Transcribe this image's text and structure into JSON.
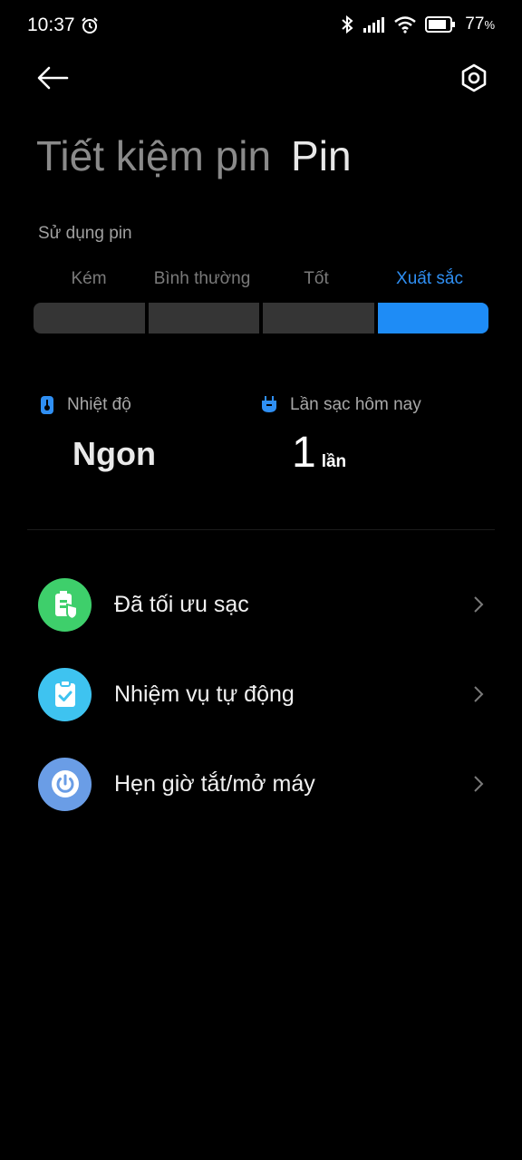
{
  "status_bar": {
    "time": "10:37",
    "battery_percent": "77",
    "battery_unit": "%"
  },
  "header": {
    "title_primary": "Tiết kiệm pin",
    "title_secondary": "Pin"
  },
  "battery_usage": {
    "label": "Sử dụng pin",
    "levels": [
      "Kém",
      "Bình thường",
      "Tốt",
      "Xuất sắc"
    ],
    "active_level": "Xuất sắc"
  },
  "stats": {
    "temperature_label": "Nhiệt độ",
    "temperature_value": "Ngon",
    "charges_label": "Lần sạc hôm nay",
    "charges_value": "1",
    "charges_unit": "lần"
  },
  "menu": {
    "items": [
      {
        "label": "Đã tối ưu sạc",
        "color": "#3ecf6b",
        "icon": "battery-shield-icon"
      },
      {
        "label": "Nhiệm vụ tự động",
        "color": "#3ec3f0",
        "icon": "clipboard-check-icon"
      },
      {
        "label": "Hẹn giờ tắt/mở máy",
        "color": "#6a9de6",
        "icon": "power-icon"
      }
    ]
  },
  "colors": {
    "accent": "#1e8cf6",
    "background": "#000000"
  }
}
